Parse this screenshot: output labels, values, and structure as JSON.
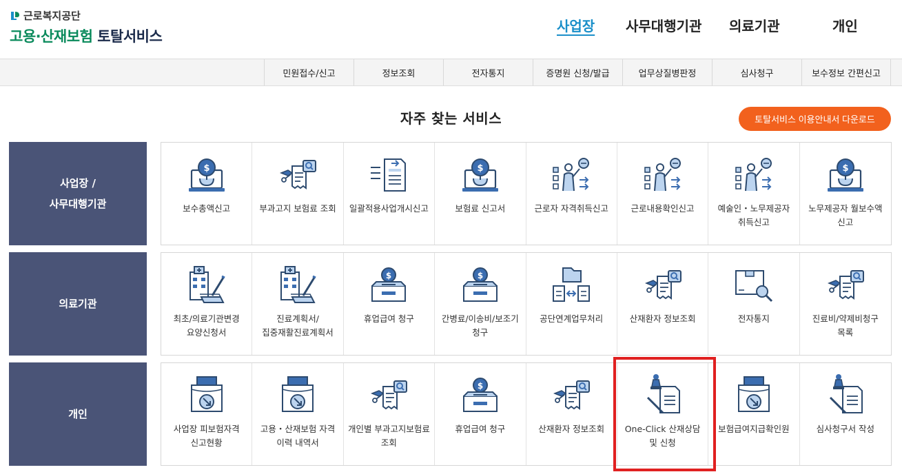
{
  "header": {
    "org_name": "근로복지공단",
    "service_title_green": "고용·산재보험",
    "service_title_dark": "토탈서비스"
  },
  "topnav": [
    {
      "label": "사업장",
      "active": true
    },
    {
      "label": "사무대행기관",
      "active": false
    },
    {
      "label": "의료기관",
      "active": false
    },
    {
      "label": "개인",
      "active": false
    }
  ],
  "menubar": [
    "민원접수/신고",
    "정보조회",
    "전자통지",
    "증명원 신청/발급",
    "업무상질병판정",
    "심사청구",
    "보수정보 간편신고"
  ],
  "section_title": "자주 찾는 서비스",
  "guide_button": "토탈서비스 이용안내서 다운로드",
  "rows": [
    {
      "label": "사업장 /\n사무대행기관",
      "items": [
        {
          "label": "보수총액신고",
          "icon": "money-laptop-icon"
        },
        {
          "label": "부과고지 보험료 조회",
          "icon": "document-search-icon"
        },
        {
          "label": "일괄적용사업개시신고",
          "icon": "document-transfer-icon"
        },
        {
          "label": "보험료 신고서",
          "icon": "money-laptop-icon"
        },
        {
          "label": "근로자 자격취득신고",
          "icon": "person-checklist-icon"
        },
        {
          "label": "근로내용확인신고",
          "icon": "person-checklist-icon"
        },
        {
          "label": "예술인・노무제공자 취득신고",
          "icon": "person-checklist-icon"
        },
        {
          "label": "노무제공자 월보수액 신고",
          "icon": "money-laptop-icon"
        }
      ]
    },
    {
      "label": "의료기관",
      "items": [
        {
          "label": "최초/의료기관변경 요양신청서",
          "icon": "hospital-pen-icon"
        },
        {
          "label": "진료계획서/집중재활진료계획서",
          "icon": "hospital-pen-icon"
        },
        {
          "label": "휴업급여 청구",
          "icon": "money-box-icon"
        },
        {
          "label": "간병료/이송비/보조기 청구",
          "icon": "money-box-icon"
        },
        {
          "label": "공단연계업무처리",
          "icon": "folder-exchange-icon"
        },
        {
          "label": "산재환자 정보조회",
          "icon": "document-search-icon"
        },
        {
          "label": "전자통지",
          "icon": "box-search-icon"
        },
        {
          "label": "진료비/약제비청구 목록",
          "icon": "document-search-icon"
        }
      ]
    },
    {
      "label": "개인",
      "items": [
        {
          "label": "사업장 피보험자격 신고현황",
          "icon": "printer-arrow-icon"
        },
        {
          "label": "고용・산재보험 자격 이력 내역서",
          "icon": "printer-arrow-icon"
        },
        {
          "label": "개인별 부과고지보험료 조회",
          "icon": "document-search-icon"
        },
        {
          "label": "휴업급여 청구",
          "icon": "money-box-icon"
        },
        {
          "label": "산재환자 정보조회",
          "icon": "document-search-icon"
        },
        {
          "label": "One-Click 산재상담 및 신청",
          "icon": "stamp-document-icon"
        },
        {
          "label": "보험급여지급확인원",
          "icon": "printer-arrow-icon"
        },
        {
          "label": "심사청구서 작성",
          "icon": "stamp-document-icon"
        }
      ]
    }
  ],
  "colors": {
    "accent": "#1a8fc9",
    "row_label_bg": "#4a5477",
    "button": "#f2611d",
    "highlight": "#e02020"
  }
}
